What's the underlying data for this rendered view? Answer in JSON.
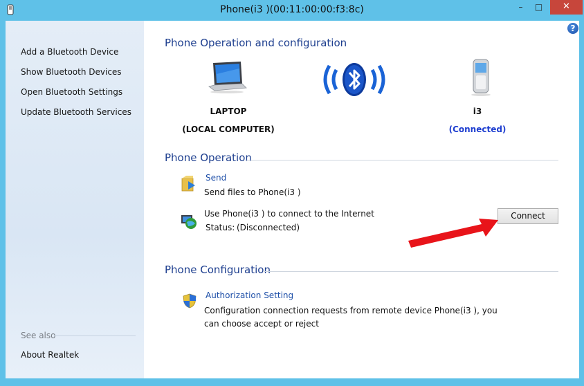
{
  "window": {
    "title": "Phone(i3  )(00:11:00:00:f3:8c)",
    "controls": {
      "minimize": "–",
      "maximize": "□",
      "close": "✕"
    }
  },
  "sidebar": {
    "items": [
      {
        "label": "Add a Bluetooth Device"
      },
      {
        "label": "Show Bluetooth Devices"
      },
      {
        "label": "Open Bluetooth Settings"
      },
      {
        "label": "Update Bluetooth Services"
      }
    ],
    "see_also": "See also",
    "about": "About Realtek"
  },
  "main": {
    "help_label": "?",
    "overview_title": "Phone Operation and configuration",
    "local_device": {
      "name": "LAPTOP",
      "subtitle": "(LOCAL COMPUTER)",
      "icon": "laptop-icon"
    },
    "center_icon": "bluetooth-icon",
    "remote_device": {
      "name": "i3",
      "status": "(Connected)",
      "icon": "phone-icon"
    },
    "operation_title": "Phone Operation",
    "send": {
      "link": "Send",
      "desc": "Send files to Phone(i3  )",
      "icon": "folder-send-icon"
    },
    "internet": {
      "desc": "Use Phone(i3  ) to connect to the Internet",
      "status_label": "Status:",
      "status_value": "(Disconnected)",
      "button": "Connect",
      "icon": "network-globe-icon"
    },
    "config_title": "Phone Configuration",
    "auth": {
      "link": "Authorization Setting",
      "desc1": "Configuration connection requests from remote device Phone(i3  ),   you",
      "desc2": "can choose accept or reject",
      "icon": "shield-icon"
    }
  },
  "colors": {
    "frame": "#5fc1e8",
    "section_title": "#1e3f8f",
    "link": "#1e4fa8",
    "connected": "#1f3fd0",
    "close_button": "#c7463b",
    "annotation_arrow": "#e8141a"
  }
}
